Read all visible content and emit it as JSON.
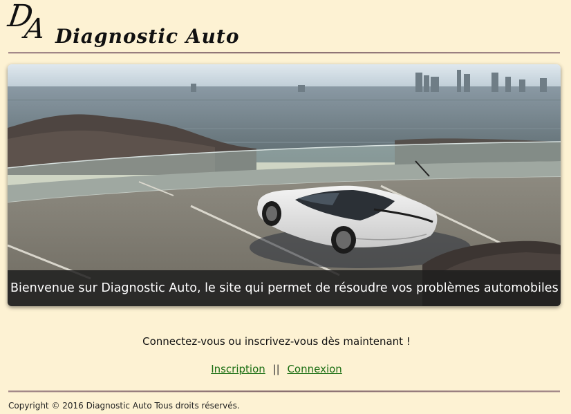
{
  "header": {
    "logo_letter_1": "D",
    "logo_letter_2": "A",
    "title": "Diagnostic Auto"
  },
  "hero": {
    "image": "car-on-parking-overlooking-city",
    "caption": "Bienvenue sur Diagnostic Auto, le site qui permet de résoudre vos problèmes automobiles"
  },
  "cta": {
    "text": "Connectez-vous ou inscrivez-vous dès maintenant !"
  },
  "links": {
    "signup": "Inscription",
    "separator": "||",
    "login": "Connexion"
  },
  "footer": {
    "copyright": "Copyright © 2016 Diagnostic Auto Tous droits réservés."
  },
  "colors": {
    "background": "#fdf2d3",
    "link": "#1a6e12",
    "caption_bg": "#1e1e1e"
  }
}
